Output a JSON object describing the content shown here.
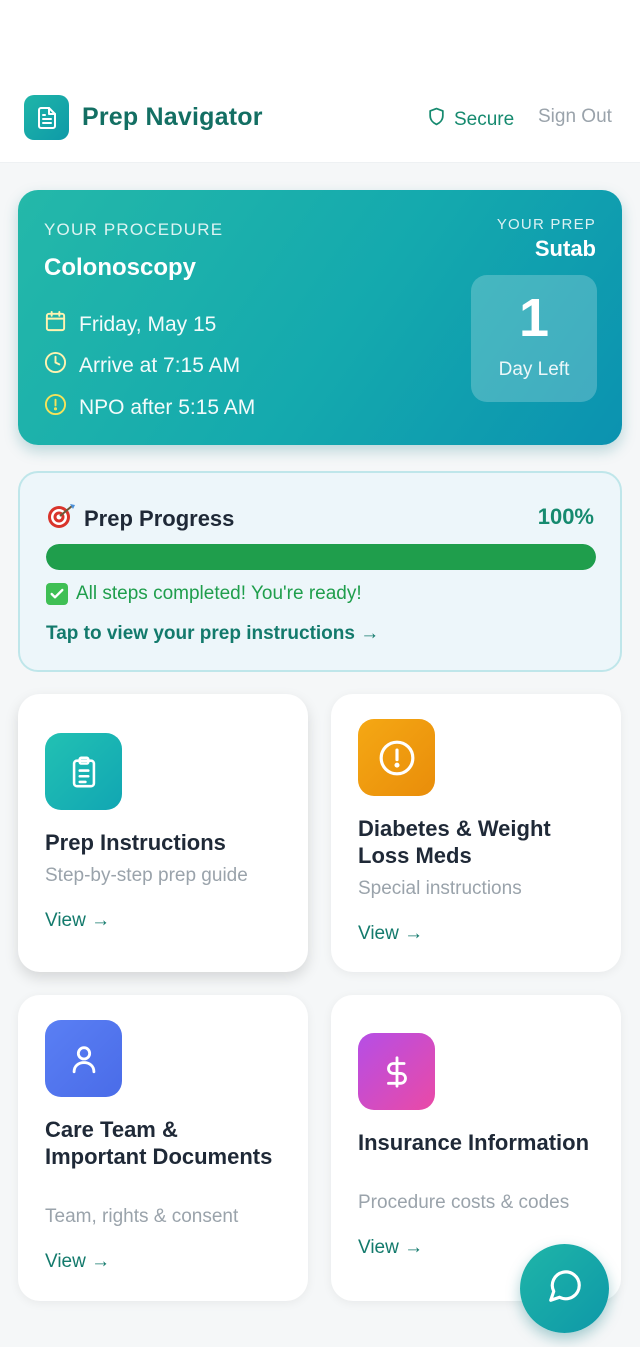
{
  "header": {
    "app_title": "Prep Navigator",
    "secure_label": "Secure",
    "sign_out_label": "Sign Out"
  },
  "procedure": {
    "section_label": "YOUR PROCEDURE",
    "name": "Colonoscopy",
    "date": "Friday, May 15",
    "arrival": "Arrive at 7:15 AM",
    "npo": "NPO after 5:15 AM",
    "prep_label": "YOUR PREP",
    "prep_name": "Sutab",
    "days_count": "1",
    "days_label": "Day Left"
  },
  "progress": {
    "title": "Prep Progress",
    "percent_label": "100%",
    "percent_value": 1.0,
    "message": "All steps completed! You're ready!",
    "link": "Tap to view your prep instructions →"
  },
  "tiles": [
    {
      "title": "Prep Instructions",
      "subtitle": "Step-by-step prep guide",
      "link": "View →",
      "icon": "clipboard-icon",
      "color": "#1fb5b0"
    },
    {
      "title": "Diabetes & Weight Loss Meds",
      "subtitle": "Special instructions",
      "link": "View →",
      "icon": "alert-circle-icon",
      "color": "#f0a012"
    },
    {
      "title": "Care Team & Important Documents",
      "subtitle": "Team, rights & consent",
      "link": "View →",
      "icon": "user-icon",
      "color": "#4f79f0"
    },
    {
      "title": "Insurance Information",
      "subtitle": "Procedure costs & codes",
      "link": "View →",
      "icon": "dollar-icon",
      "color": "#d94fc0"
    }
  ],
  "colors": {
    "brand": "#136f63",
    "accent": "#168a6f",
    "progress_fill": "#1f9e4c"
  }
}
